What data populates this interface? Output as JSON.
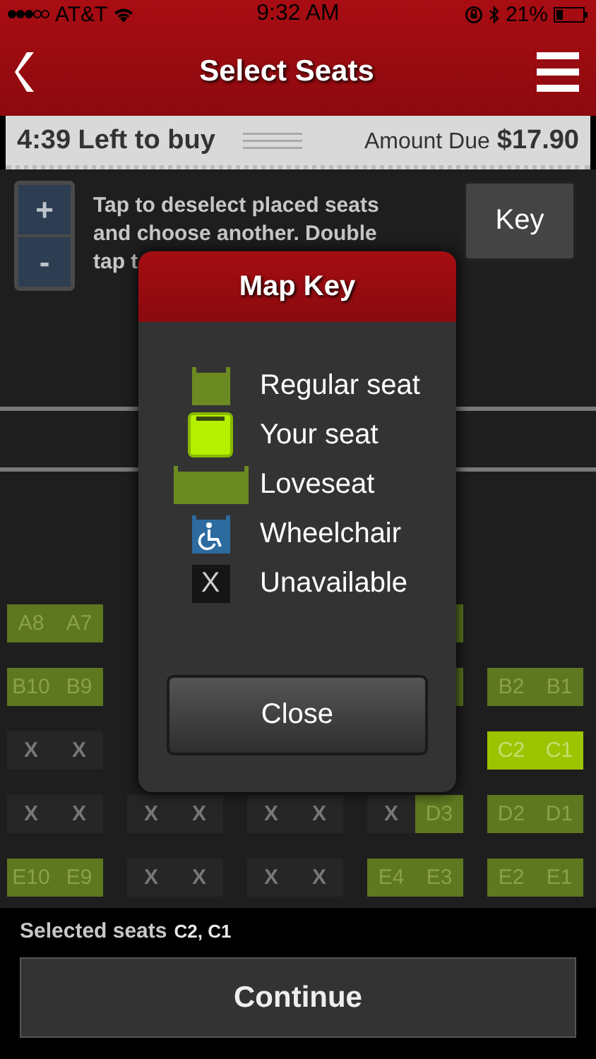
{
  "status_bar": {
    "carrier": "AT&T",
    "time": "9:32 AM",
    "battery": "21%"
  },
  "nav": {
    "title": "Select Seats"
  },
  "timer": {
    "time_left": "4:39 Left to buy",
    "amount_label": "Amount Due",
    "amount": "$17.90"
  },
  "zoom": {
    "plus": "+",
    "minus": "-"
  },
  "hint": "Tap to deselect placed seats and choose another. Double tap t",
  "key_button": "Key",
  "rows": [
    {
      "seats": [
        {
          "kind": "regular",
          "label": "A8"
        },
        {
          "kind": "regular",
          "label": "A7"
        },
        {
          "kind": "gap"
        },
        {
          "kind": "gap"
        },
        {
          "kind": "gap"
        },
        {
          "kind": "gap"
        },
        {
          "kind": "gap"
        },
        {
          "kind": "regular"
        },
        {
          "kind": "gap"
        },
        {
          "kind": "gap"
        }
      ]
    },
    {
      "seats": [
        {
          "kind": "regular",
          "label": "B10"
        },
        {
          "kind": "regular",
          "label": "B9"
        },
        {
          "kind": "gap"
        },
        {
          "kind": "gap"
        },
        {
          "kind": "gap"
        },
        {
          "kind": "gap"
        },
        {
          "kind": "gap"
        },
        {
          "kind": "regular"
        },
        {
          "kind": "regular",
          "label": "B2"
        },
        {
          "kind": "regular",
          "label": "B1"
        }
      ]
    },
    {
      "seats": [
        {
          "kind": "unavailable",
          "label": "X"
        },
        {
          "kind": "unavailable",
          "label": "X"
        },
        {
          "kind": "gap"
        },
        {
          "kind": "gap"
        },
        {
          "kind": "gap"
        },
        {
          "kind": "gap"
        },
        {
          "kind": "gap"
        },
        {
          "kind": "gap"
        },
        {
          "kind": "selected",
          "label": "C2"
        },
        {
          "kind": "selected",
          "label": "C1"
        }
      ]
    },
    {
      "seats": [
        {
          "kind": "unavailable",
          "label": "X"
        },
        {
          "kind": "unavailable",
          "label": "X"
        },
        {
          "kind": "unavailable",
          "label": "X"
        },
        {
          "kind": "unavailable",
          "label": "X"
        },
        {
          "kind": "unavailable",
          "label": "X"
        },
        {
          "kind": "unavailable",
          "label": "X"
        },
        {
          "kind": "unavailable",
          "label": "X"
        },
        {
          "kind": "regular",
          "label": "D3"
        },
        {
          "kind": "regular",
          "label": "D2"
        },
        {
          "kind": "regular",
          "label": "D1"
        }
      ]
    },
    {
      "seats": [
        {
          "kind": "regular",
          "label": "E10"
        },
        {
          "kind": "regular",
          "label": "E9"
        },
        {
          "kind": "unavailable",
          "label": "X"
        },
        {
          "kind": "unavailable",
          "label": "X"
        },
        {
          "kind": "unavailable",
          "label": "X"
        },
        {
          "kind": "unavailable",
          "label": "X"
        },
        {
          "kind": "regular",
          "label": "E4"
        },
        {
          "kind": "regular",
          "label": "E3"
        },
        {
          "kind": "regular",
          "label": "E2"
        },
        {
          "kind": "regular",
          "label": "E1"
        }
      ]
    }
  ],
  "selected": {
    "label": "Selected seats",
    "seats": "C2, C1"
  },
  "continue_button": "Continue",
  "modal": {
    "title": "Map Key",
    "items": [
      {
        "kind": "regular",
        "label": "Regular seat"
      },
      {
        "kind": "selected",
        "label": "Your seat"
      },
      {
        "kind": "loveseat",
        "label": "Loveseat"
      },
      {
        "kind": "wheelchair",
        "label": "Wheelchair"
      },
      {
        "kind": "unavailable",
        "label": "Unavailable",
        "symbol": "X"
      }
    ],
    "close_button": "Close"
  }
}
